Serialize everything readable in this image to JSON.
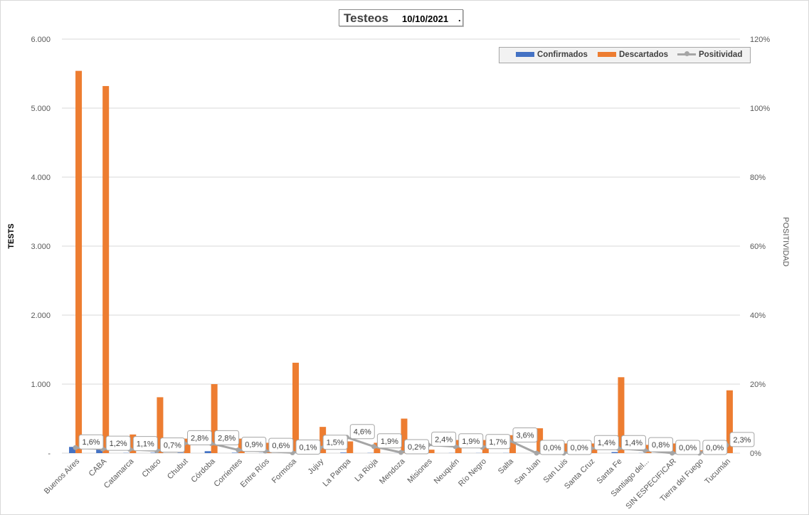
{
  "header": {
    "title": "Testeos",
    "date": "10/10/2021",
    "dot": "."
  },
  "legend": {
    "confirmed": "Confirmados",
    "discarded": "Descartados",
    "positivity": "Positividad"
  },
  "colors": {
    "confirmed": "#4472c4",
    "discarded": "#ed7d31",
    "positivity": "#a5a5a5",
    "grid": "#d9d9d9"
  },
  "chart_data": {
    "type": "bar",
    "title": "Testeos 10/10/2021",
    "ylabel": "TESTS",
    "y2label": "POSITIVIDAD",
    "ylim": [
      0,
      6000
    ],
    "y2lim": [
      0,
      1.2
    ],
    "y_ticks": [
      "-",
      "1.000",
      "2.000",
      "3.000",
      "4.000",
      "5.000",
      "6.000"
    ],
    "y2_ticks": [
      "0%",
      "20%",
      "40%",
      "60%",
      "80%",
      "100%",
      "120%"
    ],
    "grid": true,
    "legend_position": "top-right",
    "categories": [
      "Buenos Aires",
      "CABA",
      "Catamarca",
      "Chaco",
      "Chubut",
      "Córdoba",
      "Corrientes",
      "Entre Ríos",
      "Formosa",
      "Jujuy",
      "La Pampa",
      "La Rioja",
      "Mendoza",
      "Misiones",
      "Neuquén",
      "Río Negro",
      "Salta",
      "San Juan",
      "San Luis",
      "Santa Cruz",
      "Santa Fe",
      "Santiago del...",
      "SIN ESPECIFICAR",
      "Tierra del Fuego",
      "Tucumán"
    ],
    "series": [
      {
        "name": "Confirmados",
        "values": [
          90,
          65,
          3,
          6,
          6,
          28,
          6,
          2,
          1,
          6,
          8,
          3,
          1,
          0,
          2,
          2,
          2,
          0,
          0,
          1,
          15,
          2,
          2,
          0,
          21
        ]
      },
      {
        "name": "Descartados",
        "values": [
          5540,
          5320,
          270,
          810,
          210,
          1000,
          210,
          150,
          1310,
          380,
          170,
          150,
          500,
          50,
          190,
          190,
          260,
          360,
          140,
          140,
          1100,
          120,
          140,
          40,
          910
        ]
      },
      {
        "name": "Positividad",
        "values": [
          0.016,
          0.012,
          0.011,
          0.007,
          0.028,
          0.028,
          0.009,
          0.006,
          0.001,
          0.015,
          0.046,
          0.019,
          0.002,
          0.024,
          0.019,
          0.017,
          0.036,
          0.0,
          0.0,
          0.014,
          0.014,
          0.008,
          0.0,
          0.0,
          0.023
        ],
        "labels": [
          "1,6%",
          "1,2%",
          "1,1%",
          "0,7%",
          "2,8%",
          "2,8%",
          "0,9%",
          "0,6%",
          "0,1%",
          "1,5%",
          "4,6%",
          "1,9%",
          "0,2%",
          "2,4%",
          "1,9%",
          "1,7%",
          "3,6%",
          "0,0%",
          "0,0%",
          "1,4%",
          "1,4%",
          "0,8%",
          "0,0%",
          "0,0%",
          "2,3%"
        ]
      }
    ]
  }
}
